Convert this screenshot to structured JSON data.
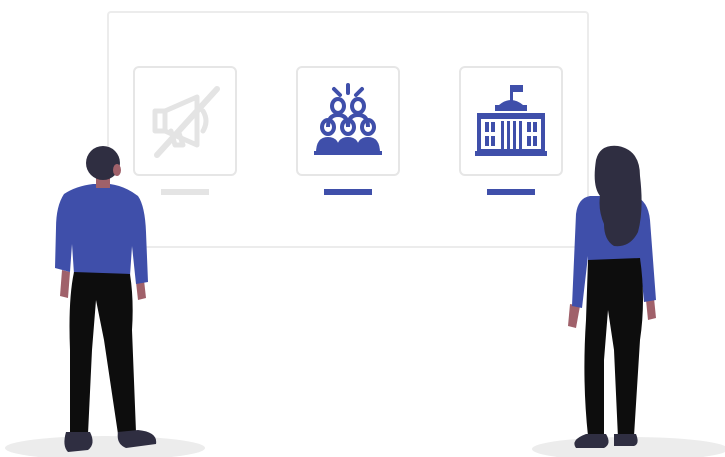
{
  "colors": {
    "accent": "#3f4faa",
    "inactive": "#e4e4e4",
    "board_border": "#ececec",
    "shirt": "#3f4faa",
    "pants": "#0d0d0d",
    "skin": "#a0616a",
    "hair": "#2f2e41",
    "shadow": "#ececec"
  },
  "cards": [
    {
      "icon": "muted-megaphone-icon",
      "state": "inactive"
    },
    {
      "icon": "crowd-icon",
      "state": "active"
    },
    {
      "icon": "government-building-icon",
      "state": "active"
    }
  ],
  "people": [
    {
      "icon": "man-person",
      "facing": "board"
    },
    {
      "icon": "woman-person",
      "facing": "board"
    }
  ]
}
